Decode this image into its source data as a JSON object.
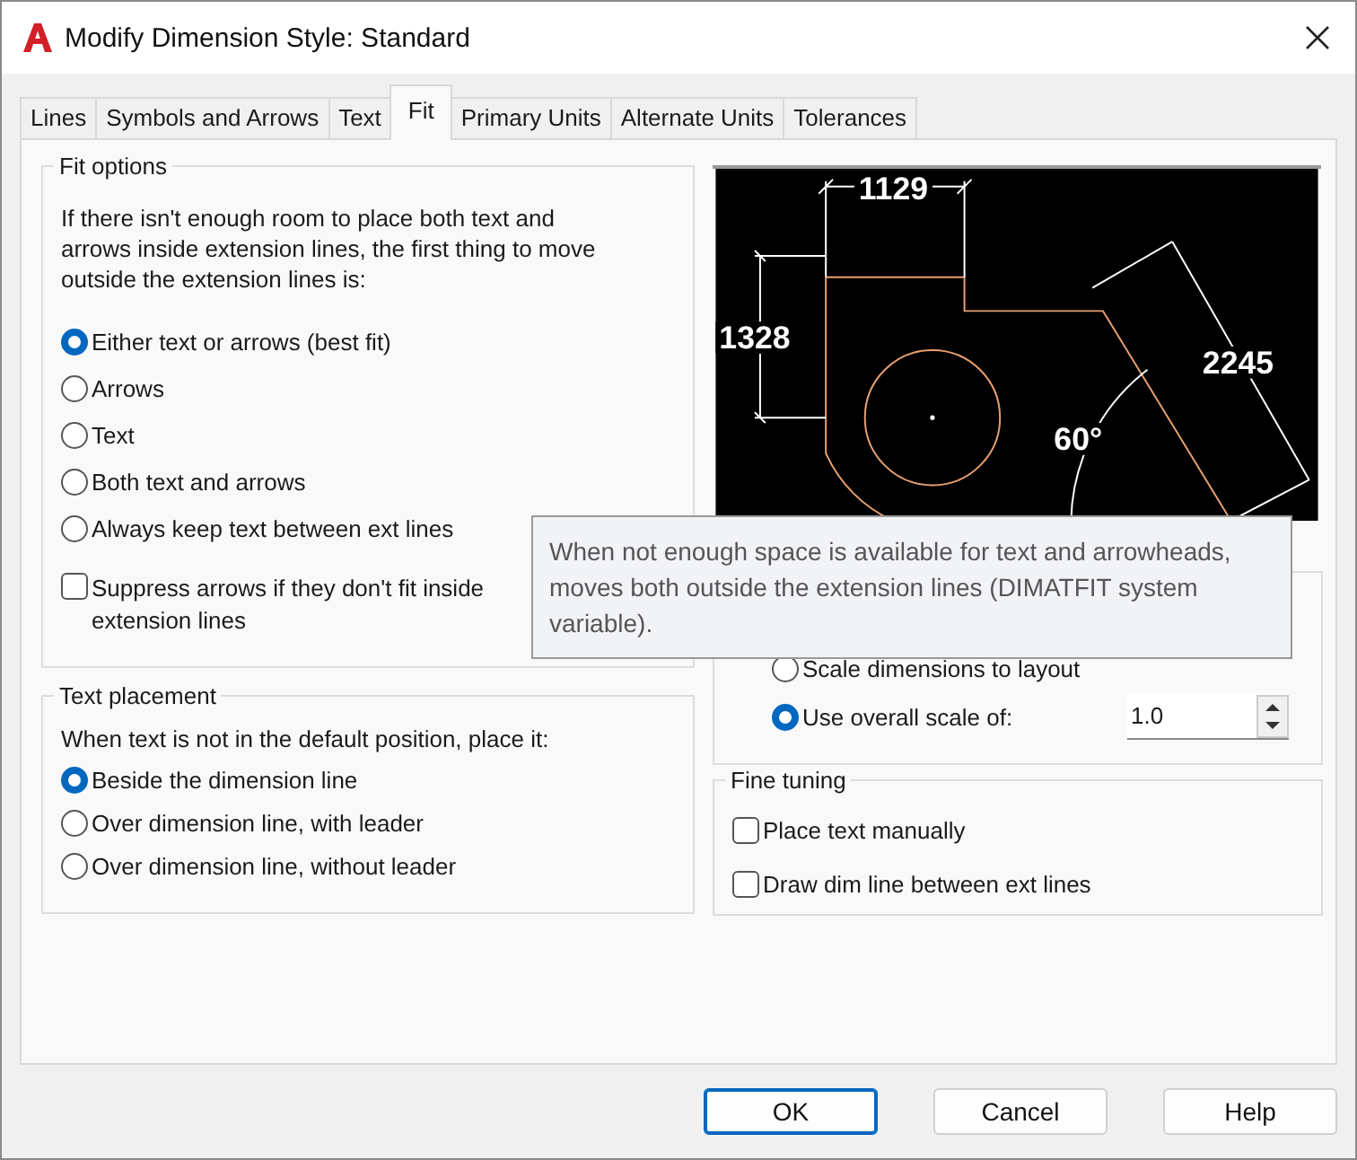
{
  "window": {
    "title": "Modify Dimension Style: Standard"
  },
  "tabs": [
    {
      "label": "Lines",
      "selected": false
    },
    {
      "label": "Symbols and Arrows",
      "selected": false
    },
    {
      "label": "Text",
      "selected": false
    },
    {
      "label": "Fit",
      "selected": true
    },
    {
      "label": "Primary Units",
      "selected": false
    },
    {
      "label": "Alternate Units",
      "selected": false
    },
    {
      "label": "Tolerances",
      "selected": false
    }
  ],
  "fit_options": {
    "title": "Fit options",
    "description": "If there isn't enough room to place both text and arrows inside extension lines, the first thing to move outside the extension lines is:",
    "options": [
      {
        "label": "Either text or arrows (best fit)",
        "selected": true
      },
      {
        "label": "Arrows",
        "selected": false
      },
      {
        "label": "Text",
        "selected": false
      },
      {
        "label": "Both text and arrows",
        "selected": false
      },
      {
        "label": "Always keep text between ext lines",
        "selected": false
      }
    ],
    "suppress": {
      "label": "Suppress arrows if they don't fit inside extension lines",
      "checked": false
    }
  },
  "text_placement": {
    "title": "Text placement",
    "description": "When text is not in the default position, place it:",
    "options": [
      {
        "label": "Beside the dimension line",
        "selected": true
      },
      {
        "label": "Over dimension line, with leader",
        "selected": false
      },
      {
        "label": "Over dimension line, without leader",
        "selected": false
      }
    ]
  },
  "preview": {
    "labels": [
      "1129",
      "1328",
      "2245",
      "60°"
    ]
  },
  "scale": {
    "options": [
      {
        "label": "Scale dimensions to layout",
        "selected": false
      },
      {
        "label": "Use overall scale of:",
        "selected": true
      }
    ],
    "value": "1.0"
  },
  "fine_tuning": {
    "title": "Fine tuning",
    "options": [
      {
        "label": "Place text manually",
        "checked": false
      },
      {
        "label": "Draw dim line between ext lines",
        "checked": false
      }
    ]
  },
  "tooltip": {
    "text": "When not enough space is available for text and arrowheads, moves both outside the extension lines (DIMATFIT system variable)."
  },
  "buttons": [
    {
      "label": "OK",
      "default": true
    },
    {
      "label": "Cancel",
      "default": false
    },
    {
      "label": "Help",
      "default": false
    }
  ]
}
